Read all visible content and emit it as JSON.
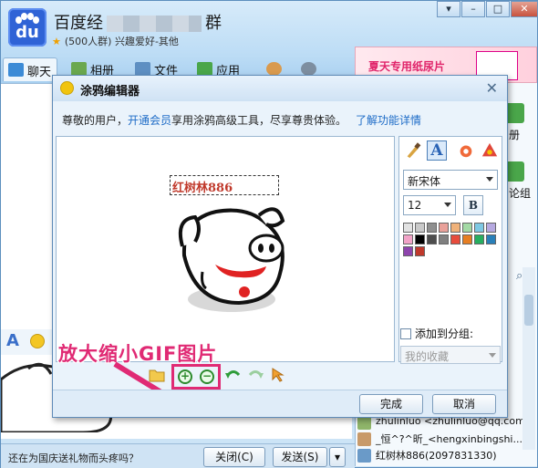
{
  "main_window": {
    "group_name_prefix": "百度经",
    "group_name_suffix": "群",
    "group_info": "(500人群) 兴趣爱好-其他",
    "logo_text": "du",
    "tabs": [
      {
        "label": "聊天",
        "icon": "chat-icon"
      },
      {
        "label": "相册",
        "icon": "photo-album-icon"
      },
      {
        "label": "文件",
        "icon": "folder-icon"
      },
      {
        "label": "应用",
        "icon": "apps-icon"
      }
    ],
    "ad_text": "夏天专用纸尿片",
    "right_panel_labels": [
      "册",
      "论组"
    ],
    "members": [
      "zhulinluo <zhulinluo@qq.com>",
      "_恒^?^昕_<hengxinbingshi...",
      "红树林886(2097831330)"
    ],
    "bottom_tip": "还在为国庆送礼物而头疼吗？",
    "close_button": "关闭(C)",
    "send_button": "发送(S)"
  },
  "dialog": {
    "title": "涂鸦编辑器",
    "notice_prefix": "尊敬的用户，",
    "notice_link": "开通会员",
    "notice_middle": "享用涂鸦高级工具，尽享尊贵体验。",
    "notice_link2": "了解功能详情",
    "canvas_text": "红树林886",
    "annotation_label": "放大缩小GIF图片",
    "font_name": "新宋体",
    "font_size": "12",
    "bold_label": "B",
    "add_to_group_label": "添加到分组:",
    "group_select_value": "我的收藏",
    "ok_button": "完成",
    "cancel_button": "取消",
    "palette": [
      "#e2e2e2",
      "#c9c9c9",
      "#8f8f8f",
      "#e9a19a",
      "#f0b27a",
      "#a3d9a5",
      "#7ec8e3",
      "#b6a9e0",
      "#f2a3c7",
      "#000000",
      "#4d4d4d",
      "#808080",
      "#e74c3c",
      "#e67e22",
      "#27ae60",
      "#2980b9",
      "#8e44ad",
      "#c0392b"
    ]
  },
  "colors": {
    "accent_pink": "#e02a74",
    "link_blue": "#1e6cc7",
    "canvas_text_red": "#c0392b"
  }
}
